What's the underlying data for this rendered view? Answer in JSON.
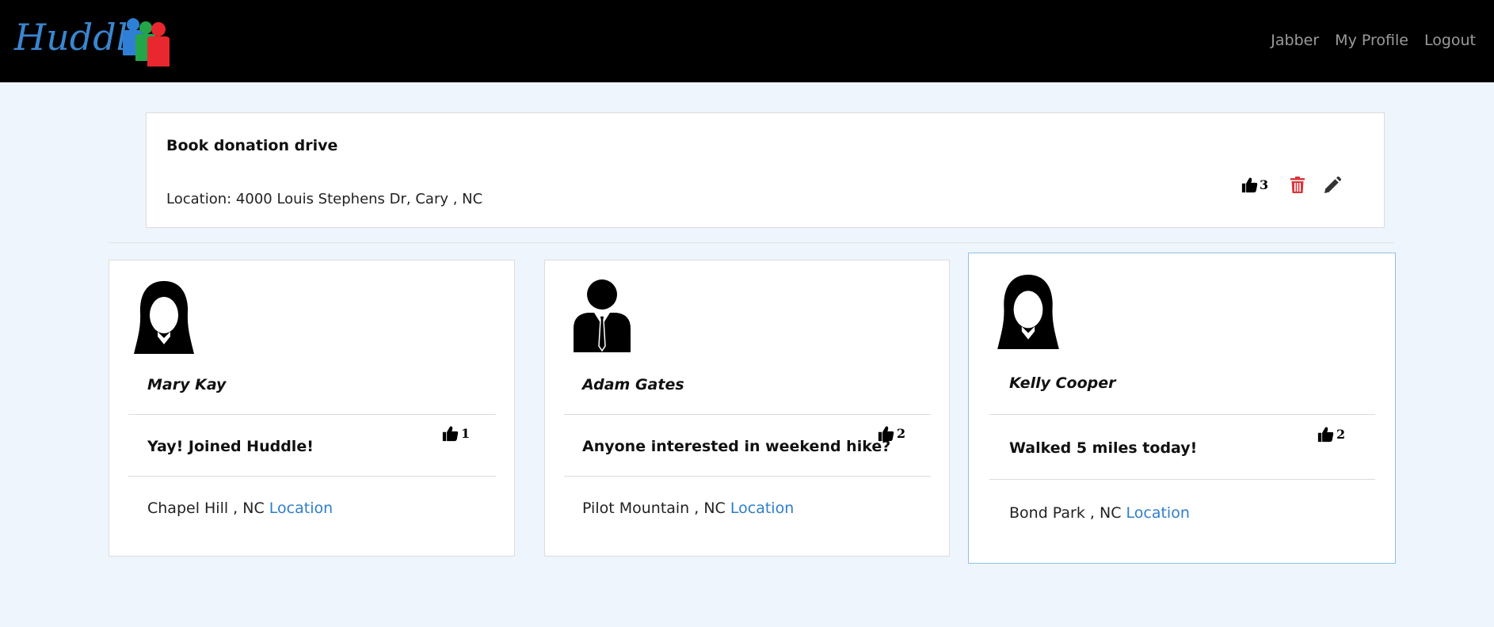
{
  "navbar": {
    "brand": "Huddle",
    "links": [
      "Jabber",
      "My Profile",
      "Logout"
    ]
  },
  "post": {
    "title": "Book donation drive",
    "location": "Location: 4000 Louis Stephens Dr, Cary , NC",
    "likes": "3"
  },
  "cards": [
    {
      "name": "Mary Kay",
      "avatar": "female-avatar-icon",
      "status": "Yay! Joined Huddle!",
      "likes": "1",
      "place": "Chapel Hill , NC",
      "location_link": "Location"
    },
    {
      "name": "Adam Gates",
      "avatar": "male-avatar-icon",
      "status": "Anyone interested in weekend hike?",
      "likes": "2",
      "place": "Pilot Mountain , NC",
      "location_link": "Location"
    },
    {
      "name": "Kelly Cooper",
      "avatar": "female-avatar-icon",
      "status": "Walked 5 miles today!",
      "likes": "2",
      "place": "Bond Park , NC",
      "location_link": "Location"
    }
  ],
  "colors": {
    "navbar_bg": "#000000",
    "page_bg": "#eff5fc",
    "brand": "#3a86d0",
    "link": "#2f7ec8",
    "delete": "#d9363e",
    "highlight_border": "#8ec0e8"
  }
}
